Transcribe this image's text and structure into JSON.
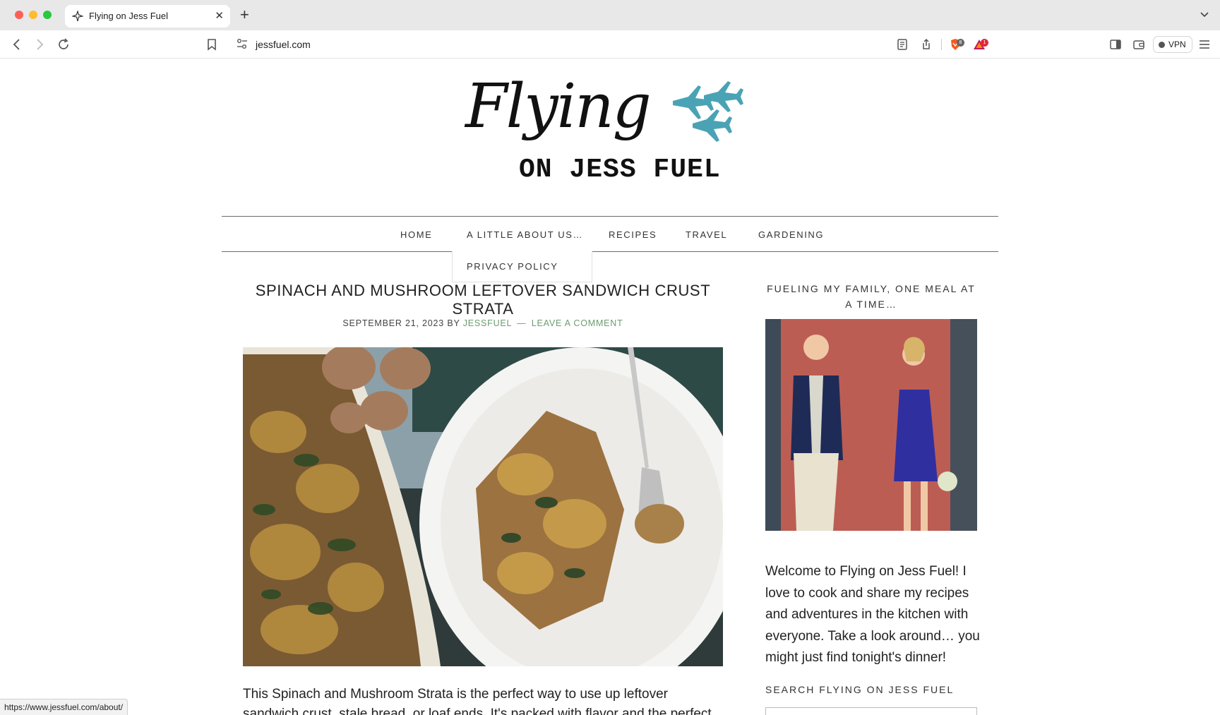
{
  "browser": {
    "tab_title": "Flying on Jess Fuel",
    "url": "jessfuel.com",
    "vpn_label": "VPN",
    "shields_badge": "8",
    "rewards_badge": "1",
    "status_url": "https://www.jessfuel.com/about/"
  },
  "site": {
    "logo_script": "Flying",
    "logo_subtitle": "ON JESS FUEL"
  },
  "nav": {
    "items": [
      "HOME",
      "A LITTLE ABOUT US…",
      "RECIPES",
      "TRAVEL",
      "GARDENING"
    ],
    "dropdown_item": "PRIVACY POLICY"
  },
  "post": {
    "title": "SPINACH AND MUSHROOM LEFTOVER SANDWICH CRUST STRATA",
    "date": "SEPTEMBER 21, 2023",
    "by": "BY",
    "author": "JESSFUEL",
    "separator": "—",
    "comment_link": "LEAVE A COMMENT",
    "excerpt": "This Spinach and Mushroom Strata is the perfect way to use up leftover sandwich crust, stale bread, or loaf ends. It's packed with flavor and the perfect"
  },
  "sidebar": {
    "title": "FUELING MY FAMILY, ONE MEAL AT A TIME…",
    "welcome": "Welcome to Flying on Jess Fuel! I love to cook and share my recipes and adventures in the kitchen with everyone. Take a look around… you might just find tonight's dinner!",
    "search_title": "SEARCH FLYING ON JESS FUEL"
  }
}
